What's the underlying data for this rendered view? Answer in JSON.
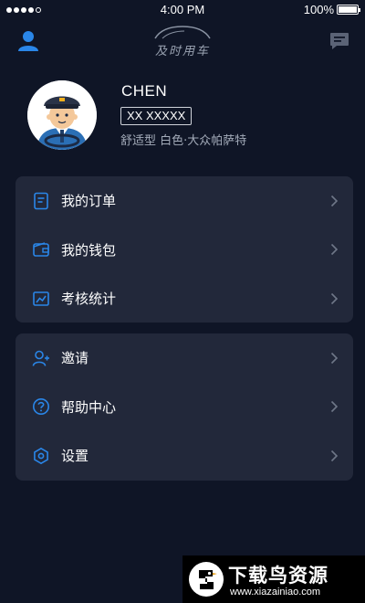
{
  "status_bar": {
    "time": "4:00 PM",
    "battery": "100%"
  },
  "header": {
    "app_name": "及时用车"
  },
  "profile": {
    "name": "CHEN",
    "plate": "XX XXXXX",
    "car_info": "舒适型  白色·大众帕萨特"
  },
  "menu_group_1": [
    {
      "label": "我的订单",
      "icon": "order-document-icon"
    },
    {
      "label": "我的钱包",
      "icon": "wallet-icon"
    },
    {
      "label": "考核统计",
      "icon": "statistics-chart-icon"
    }
  ],
  "menu_group_2": [
    {
      "label": "邀请",
      "icon": "invite-user-icon"
    },
    {
      "label": "帮助中心",
      "icon": "help-icon"
    },
    {
      "label": "设置",
      "icon": "settings-icon"
    }
  ],
  "watermark": {
    "title": "下载鸟资源",
    "url": "www.xiazainiao.com"
  },
  "colors": {
    "accent": "#2a86e8",
    "background": "#0f1526",
    "card": "#22283a"
  }
}
